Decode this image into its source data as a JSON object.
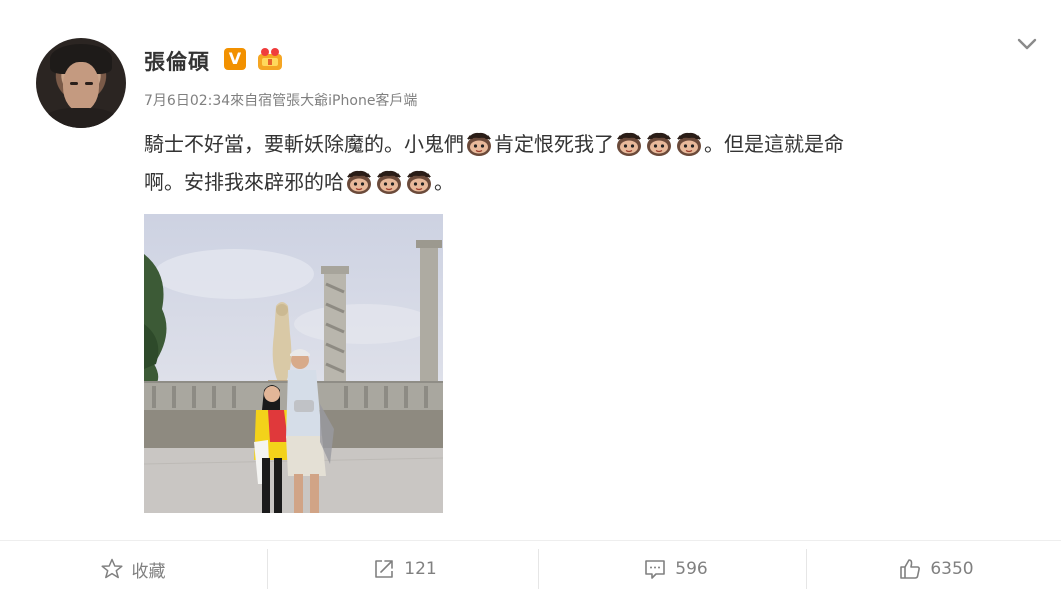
{
  "user": {
    "name": "張倫碩",
    "verified_badge": "V",
    "accent": "#f29100"
  },
  "post": {
    "date": "7月6日02:34",
    "source_prefix": "來自",
    "source": "宿管張大爺iPhone客戶端",
    "text_line1_part1": "騎士不好當，要斬妖除魔的。小鬼們",
    "text_line1_part2": "肯定恨死我了",
    "text_line1_part3": "。但是這就是命",
    "text_line2_part1": "啊。安排我來辟邪的哈",
    "text_line2_part2": "。",
    "emoji_icon": "little-ghost-emoji-icon"
  },
  "actions": {
    "favorite_label": "收藏",
    "repost_count": "121",
    "comment_count": "596",
    "like_count": "6350"
  }
}
